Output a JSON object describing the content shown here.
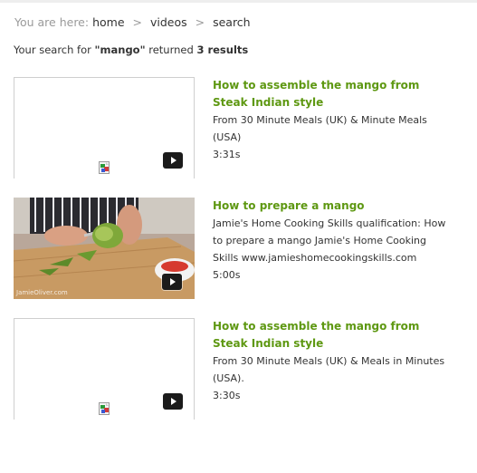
{
  "breadcrumb": {
    "prefix": "You are here:",
    "items": [
      "home",
      "videos",
      "search"
    ],
    "separator": ">"
  },
  "summary": {
    "text_before": "Your search for ",
    "query": "\"mango\"",
    "text_middle": " returned ",
    "count": "3 results"
  },
  "results": [
    {
      "title": "How to assemble the mango from Steak Indian style",
      "description": "From 30 Minute Meals (UK) & Minute Meals (USA)",
      "duration": "3:31s",
      "thumbnail": "empty"
    },
    {
      "title": "How to prepare a mango",
      "description": "Jamie's Home Cooking Skills qualification: How to prepare a mango Jamie's Home Cooking Skills www.jamieshomecookingskills.com",
      "duration": "5:00s",
      "thumbnail": "photo",
      "watermark": "JamieOliver.com"
    },
    {
      "title": "How to assemble the mango from Steak Indian style",
      "description": "From 30 Minute Meals (UK) & Meals in Minutes (USA).",
      "duration": "3:30s",
      "thumbnail": "empty"
    }
  ],
  "colors": {
    "title_green": "#5e9812",
    "breadcrumb_muted": "#9a9a9a",
    "text": "#333333"
  },
  "icons": {
    "play": "play-icon",
    "broken_image": "broken-image-icon"
  }
}
